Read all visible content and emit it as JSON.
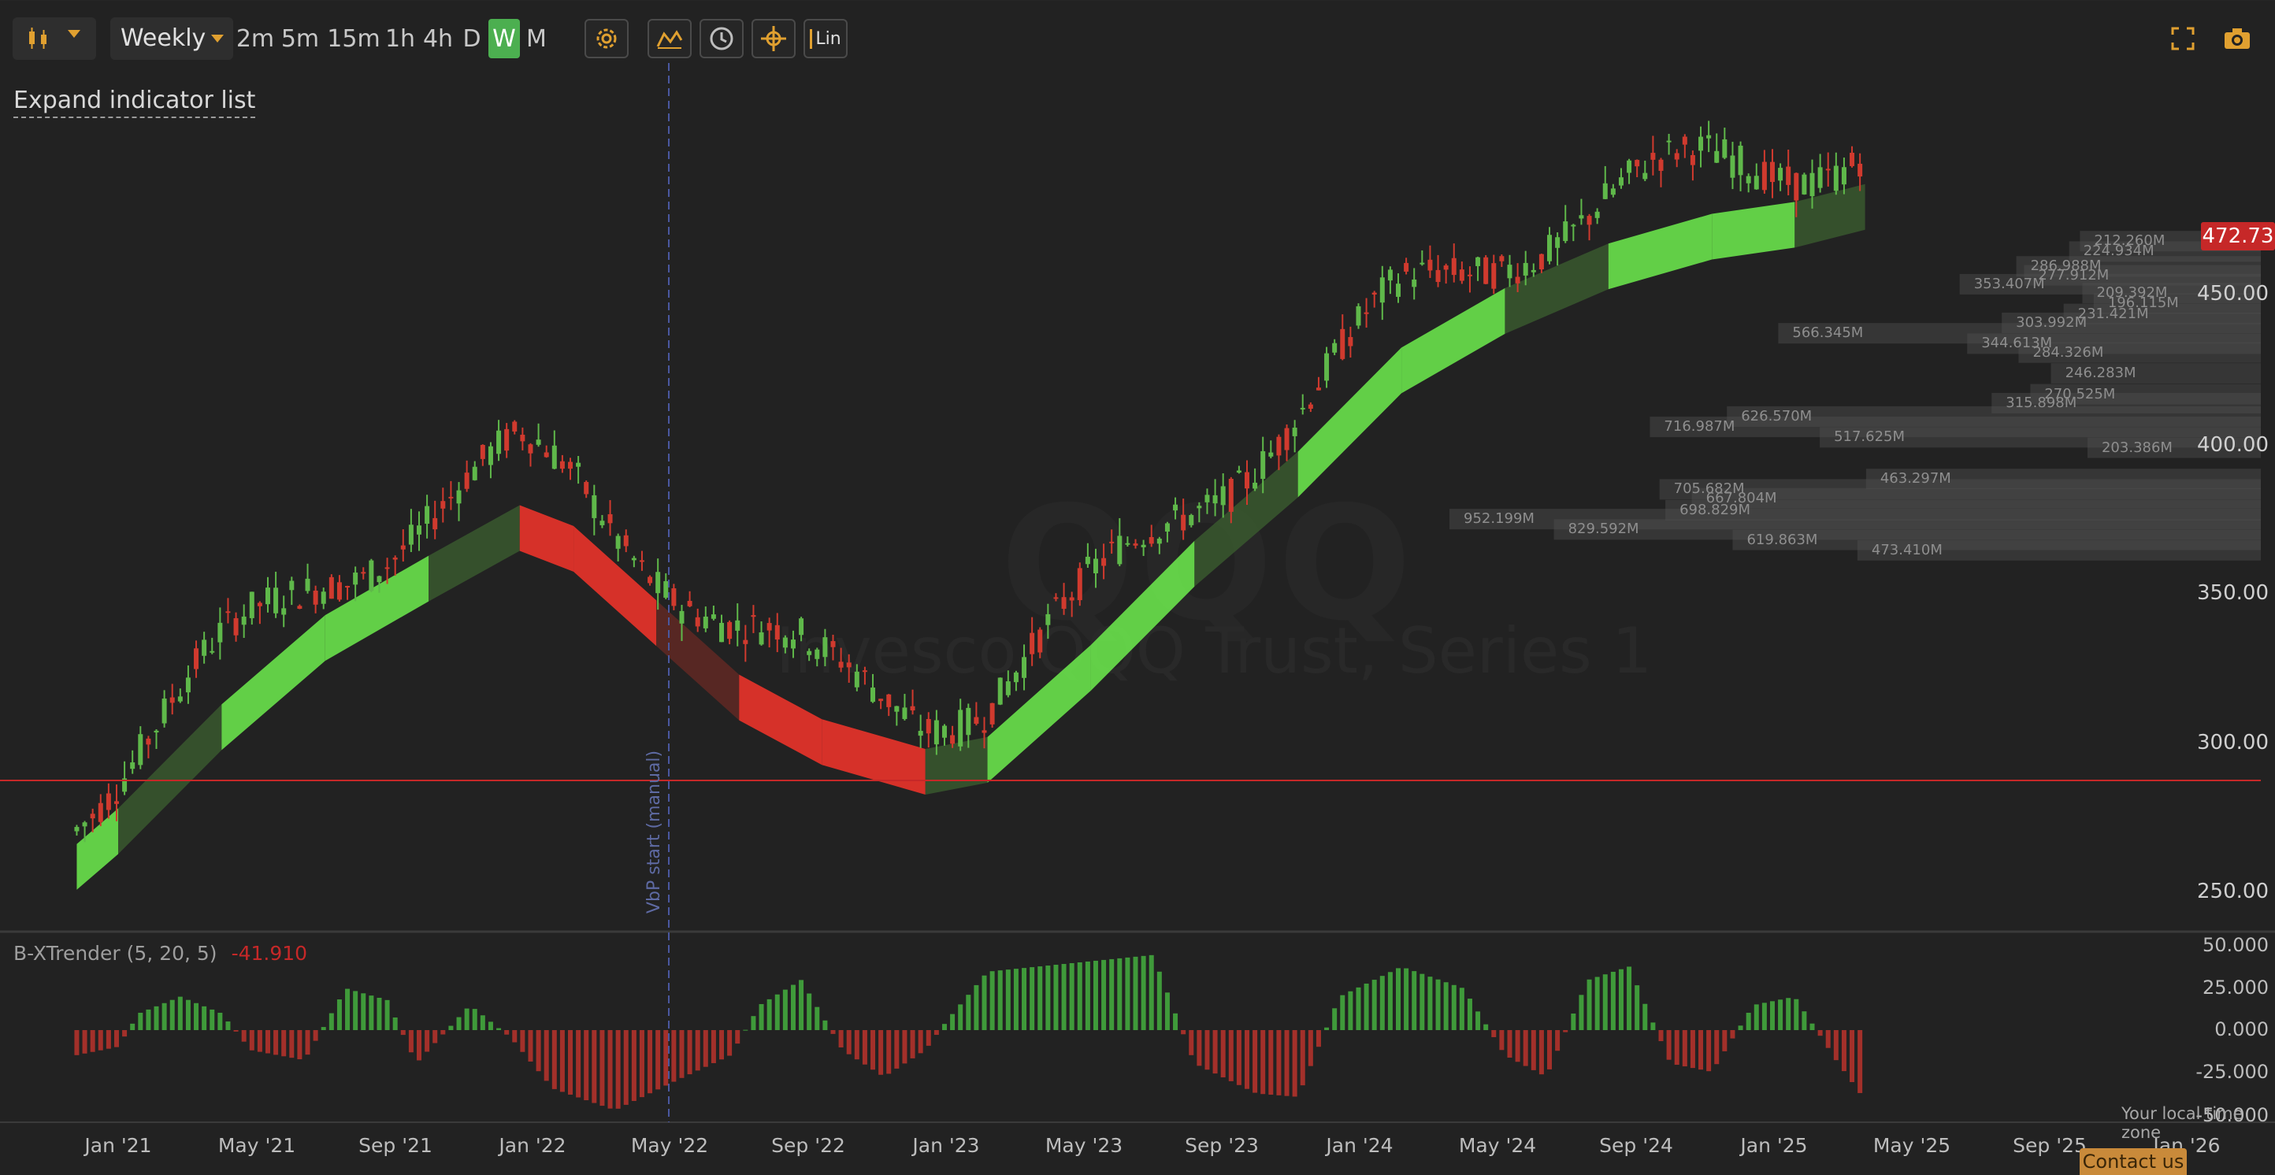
{
  "toolbar": {
    "chart_type_icon": "candlestick-icon",
    "interval": "Weekly",
    "periods": [
      "2m",
      "5m",
      "15m",
      "1h",
      "4h",
      "D",
      "W",
      "M"
    ],
    "active_period": "W",
    "tools": [
      "settings-icon",
      "indicator-icon",
      "clock-icon",
      "crosshair-icon",
      "log-linear-icon"
    ],
    "scale_label": "Lin",
    "fullscreen_icon": "fullscreen-icon",
    "snapshot_icon": "camera-icon"
  },
  "expand_indicator_label": "Expand indicator list",
  "watermark": {
    "symbol": "QQQ",
    "name": "Invesco QQQ Trust, Series 1"
  },
  "vbp_label": "VbP start (manual)",
  "current_price": "472.73",
  "price_axis": [
    "450.00",
    "400.00",
    "350.00",
    "300.00",
    "250.00"
  ],
  "oscillator_axis": [
    "50.000",
    "25.000",
    "0.000",
    "-25.000",
    "-50.000"
  ],
  "indicator": {
    "name": "B-XTrender (5, 20, 5)",
    "value": "-41.910"
  },
  "date_axis": [
    "Jan '21",
    "May '21",
    "Sep '21",
    "Jan '22",
    "May '22",
    "Sep '22",
    "Jan '23",
    "May '23",
    "Sep '23",
    "Jan '24",
    "May '24",
    "Sep '24",
    "Jan '25",
    "May '25",
    "Sep '25",
    "Jan '26"
  ],
  "volume_profile": [
    {
      "price": 468.5,
      "value": "212.260M",
      "width": 212.26
    },
    {
      "price": 465,
      "value": "224.934M",
      "width": 224.934
    },
    {
      "price": 460,
      "value": "286.988M",
      "width": 286.988
    },
    {
      "price": 457,
      "value": "277.912M",
      "width": 277.912
    },
    {
      "price": 454,
      "value": "353.407M",
      "width": 353.407
    },
    {
      "price": 451,
      "value": "209.392M",
      "width": 209.392
    },
    {
      "price": 447.5,
      "value": "196.115M",
      "width": 196.115
    },
    {
      "price": 444,
      "value": "231.421M",
      "width": 231.421
    },
    {
      "price": 441,
      "value": "303.992M",
      "width": 303.992
    },
    {
      "price": 437.5,
      "value": "566.345M",
      "width": 566.345
    },
    {
      "price": 434,
      "value": "344.613M",
      "width": 344.613
    },
    {
      "price": 431,
      "value": "284.326M",
      "width": 284.326
    },
    {
      "price": 424,
      "value": "246.283M",
      "width": 246.283
    },
    {
      "price": 417,
      "value": "270.525M",
      "width": 270.525
    },
    {
      "price": 414,
      "value": "315.898M",
      "width": 315.898
    },
    {
      "price": 409.5,
      "value": "626.570M",
      "width": 626.57
    },
    {
      "price": 406,
      "value": "716.987M",
      "width": 716.987
    },
    {
      "price": 402.5,
      "value": "517.625M",
      "width": 517.625
    },
    {
      "price": 399,
      "value": "203.386M",
      "width": 203.386
    },
    {
      "price": 388.5,
      "value": "463.297M",
      "width": 463.297
    },
    {
      "price": 385,
      "value": "705.682M",
      "width": 705.682
    },
    {
      "price": 382,
      "value": "667.804M",
      "width": 667.804
    },
    {
      "price": 378,
      "value": "698.829M",
      "width": 698.829
    },
    {
      "price": 375,
      "value": "952.199M",
      "width": 952.199
    },
    {
      "price": 371.5,
      "value": "829.592M",
      "width": 829.592
    },
    {
      "price": 368,
      "value": "619.863M",
      "width": 619.863
    },
    {
      "price": 364.5,
      "value": "473.410M",
      "width": 473.41
    }
  ],
  "colors": {
    "background": "#222222",
    "bull": "#66d94a",
    "bear": "#e0332a",
    "band_bull": "#3c6030",
    "band_bear": "#6a2a24",
    "hline": "#c62828",
    "vline": "#4a58a0"
  },
  "chart_data": {
    "type": "candlestick",
    "symbol": "QQQ",
    "interval": "Weekly",
    "x_range": [
      "Nov '20",
      "Mar '26"
    ],
    "ylim": [
      245,
      475
    ],
    "last_price": 472.73,
    "horizontal_line": 299,
    "trend_band": {
      "x": [
        2020.9,
        2021.0,
        2021.25,
        2021.5,
        2021.75,
        2021.97,
        2022.1,
        2022.3,
        2022.5,
        2022.7,
        2022.95,
        2023.1,
        2023.35,
        2023.6,
        2023.85,
        2024.1,
        2024.35,
        2024.6,
        2024.85,
        2025.05,
        2025.22
      ],
      "mid": [
        258,
        270,
        305,
        335,
        355,
        372,
        365,
        340,
        315,
        300,
        290,
        294,
        325,
        360,
        390,
        425,
        445,
        460,
        470,
        474,
        480
      ],
      "state": [
        "bull",
        "bull",
        "bull",
        "bull",
        "bull",
        "bear",
        "bear",
        "bear",
        "bear",
        "bear",
        "bull",
        "bull",
        "bull",
        "bull",
        "bull",
        "bull",
        "bull",
        "bull",
        "bull",
        "bull",
        "bull"
      ]
    },
    "oscillator": {
      "name": "B-XTrender (5, 20, 5)",
      "last": -41.91,
      "ylim": [
        -60,
        60
      ],
      "segments": [
        [
          2020.9,
          -15
        ],
        [
          2021.0,
          -10
        ],
        [
          2021.05,
          10
        ],
        [
          2021.15,
          20
        ],
        [
          2021.25,
          10
        ],
        [
          2021.32,
          -12
        ],
        [
          2021.45,
          -18
        ],
        [
          2021.55,
          25
        ],
        [
          2021.65,
          18
        ],
        [
          2021.72,
          -20
        ],
        [
          2021.85,
          15
        ],
        [
          2021.95,
          -5
        ],
        [
          2022.05,
          -35
        ],
        [
          2022.2,
          -48
        ],
        [
          2022.35,
          -30
        ],
        [
          2022.48,
          -15
        ],
        [
          2022.55,
          15
        ],
        [
          2022.65,
          30
        ],
        [
          2022.75,
          -12
        ],
        [
          2022.85,
          -28
        ],
        [
          2022.95,
          -12
        ],
        [
          2023.0,
          5
        ],
        [
          2023.1,
          35
        ],
        [
          2023.3,
          40
        ],
        [
          2023.5,
          45
        ],
        [
          2023.6,
          -20
        ],
        [
          2023.75,
          -38
        ],
        [
          2023.85,
          -40
        ],
        [
          2023.95,
          20
        ],
        [
          2024.1,
          38
        ],
        [
          2024.25,
          25
        ],
        [
          2024.35,
          -15
        ],
        [
          2024.45,
          -28
        ],
        [
          2024.55,
          30
        ],
        [
          2024.65,
          38
        ],
        [
          2024.75,
          -20
        ],
        [
          2024.85,
          -25
        ],
        [
          2024.95,
          15
        ],
        [
          2025.05,
          20
        ],
        [
          2025.15,
          -18
        ],
        [
          2025.22,
          -41.91
        ]
      ]
    }
  }
}
